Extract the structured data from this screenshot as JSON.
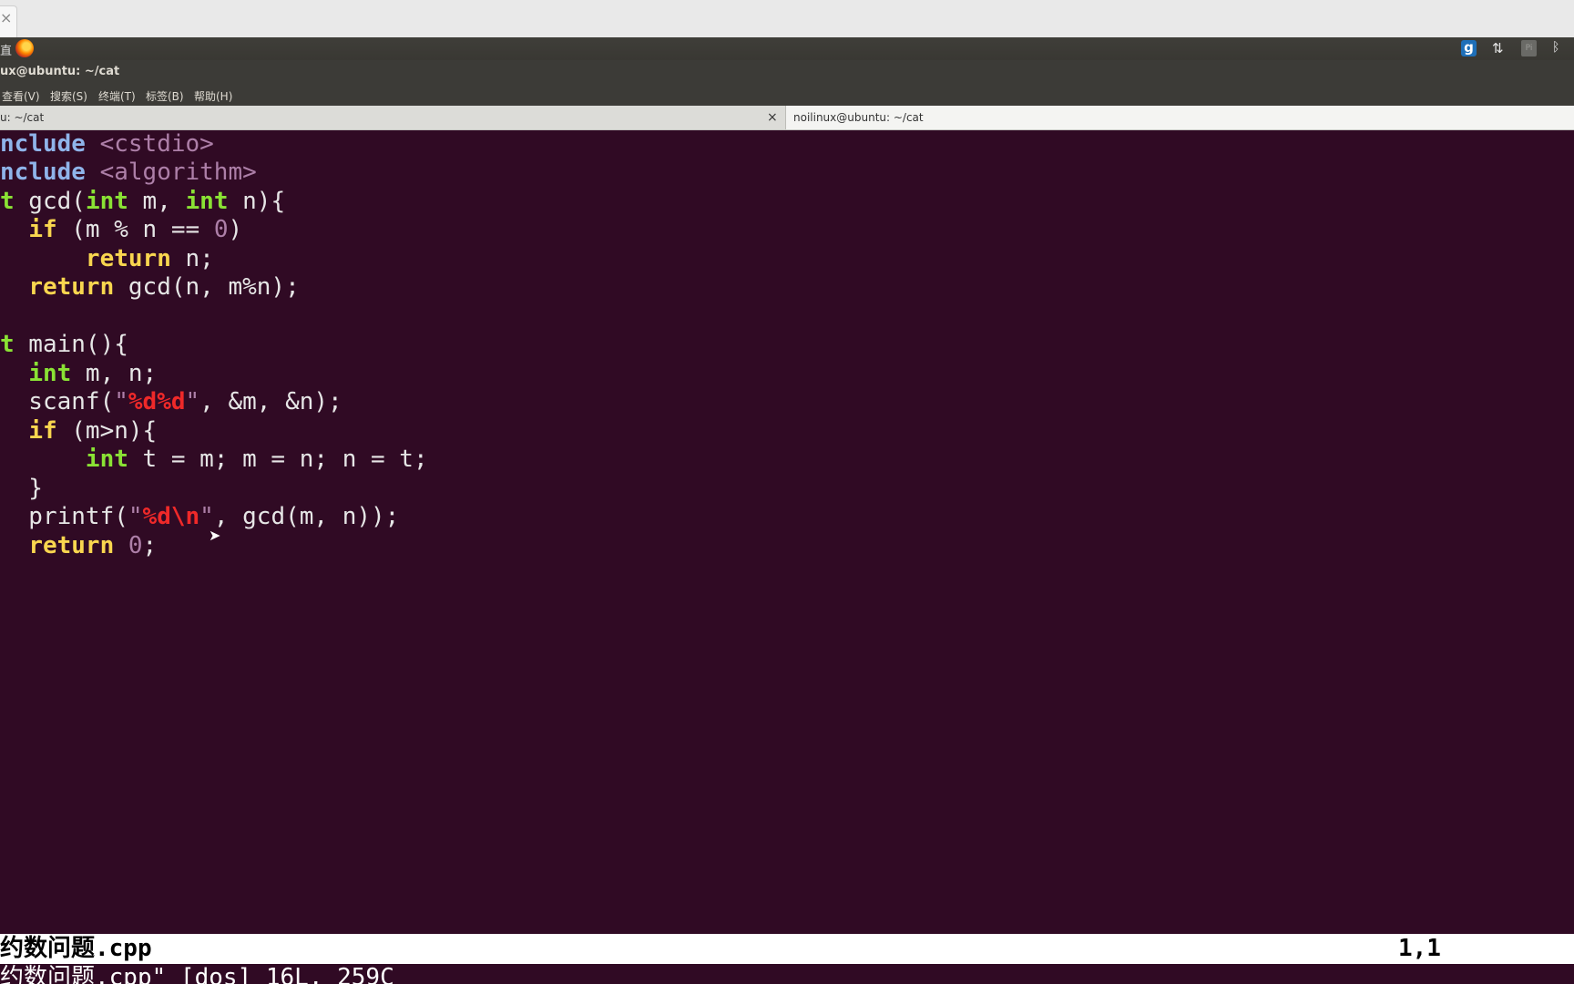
{
  "browser": {
    "tab_close_glyph": "×"
  },
  "panel": {
    "left_glyph": "直",
    "indicators": {
      "g_label": "g",
      "network_glyph": "⇅",
      "pi_label": "Pi",
      "bluetooth_glyph": "ᛒ"
    }
  },
  "window": {
    "title": "ux@ubuntu: ~/cat"
  },
  "menubar": {
    "items": [
      "查看(V)",
      "搜索(S)",
      "终端(T)",
      "标签(B)",
      "帮助(H)"
    ]
  },
  "terminal_tabs": [
    {
      "label": "u: ~/cat",
      "close": "×",
      "active": true
    },
    {
      "label": "noilinux@ubuntu: ~/cat",
      "active": false
    }
  ],
  "editor": {
    "colors": {
      "background": "#300a24",
      "keyword": "#f9d64f",
      "type": "#8ae234",
      "preproc": "#8fb4ea",
      "string": "#ef2929",
      "number": "#ad7fa8"
    },
    "lines": [
      "nclude <cstdio>",
      "nclude <algorithm>",
      "t gcd(int m, int n){",
      "  if (m % n == 0)",
      "      return n;",
      "  return gcd(n, m%n);",
      "",
      "t main(){",
      "  int m, n;",
      "  scanf(\"%d%d\", &m, &n);",
      "  if (m>n){",
      "      int t = m; m = n; n = t;",
      "  }",
      "  printf(\"%d\\n\", gcd(m, n));",
      "  return 0;"
    ]
  },
  "status": {
    "filename": "约数问题.cpp",
    "position": "1,1"
  },
  "message": "约数问题.cpp\" [dos] 16L, 259C"
}
